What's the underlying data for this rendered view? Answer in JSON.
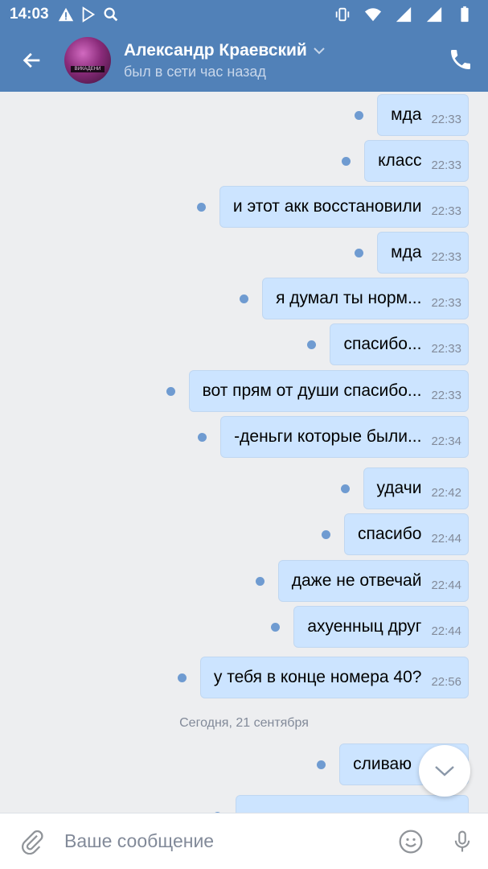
{
  "status_bar": {
    "time": "14:03"
  },
  "header": {
    "contact_name": "Александр Краевский",
    "contact_status": "был в сети час назад",
    "avatar_label": "ВИКАДЕНИ"
  },
  "colors": {
    "header_bg": "#5181b8",
    "bubble_out": "#cce4ff",
    "unread_dot": "#6f9bd1"
  },
  "messages": [
    {
      "text": "мда",
      "time": "22:33",
      "unread": true
    },
    {
      "text": "класс",
      "time": "22:33",
      "unread": true
    },
    {
      "text": "и этот акк восстановили",
      "time": "22:33",
      "unread": true
    },
    {
      "text": "мда",
      "time": "22:33",
      "unread": true
    },
    {
      "text": "я думал ты норм...",
      "time": "22:33",
      "unread": true
    },
    {
      "text": "спасибо...",
      "time": "22:33",
      "unread": true
    },
    {
      "text": "вот прям от души спасибо...",
      "time": "22:33",
      "unread": true
    },
    {
      "text": "-деньги которые были...",
      "time": "22:34",
      "unread": true
    },
    {
      "text": "удачи",
      "time": "22:42",
      "unread": true
    },
    {
      "text": "спасибо",
      "time": "22:44",
      "unread": true
    },
    {
      "text": "даже не отвечай",
      "time": "22:44",
      "unread": true
    },
    {
      "text": "ахуенныц друг",
      "time": "22:44",
      "unread": true
    },
    {
      "text": "у тебя в конце номера 40?",
      "time": "22:56",
      "unread": true
    }
  ],
  "date_separator": "Сегодня, 21 сентября",
  "today_messages": [
    {
      "text": "сливаю",
      "time": "",
      "unread": true
    }
  ],
  "composer": {
    "placeholder": "Ваше сообщение"
  },
  "icons": [
    "arrow-back-icon",
    "chevron-down-icon",
    "phone-icon",
    "chevron-down-icon",
    "paperclip-icon",
    "smile-icon",
    "microphone-icon"
  ]
}
